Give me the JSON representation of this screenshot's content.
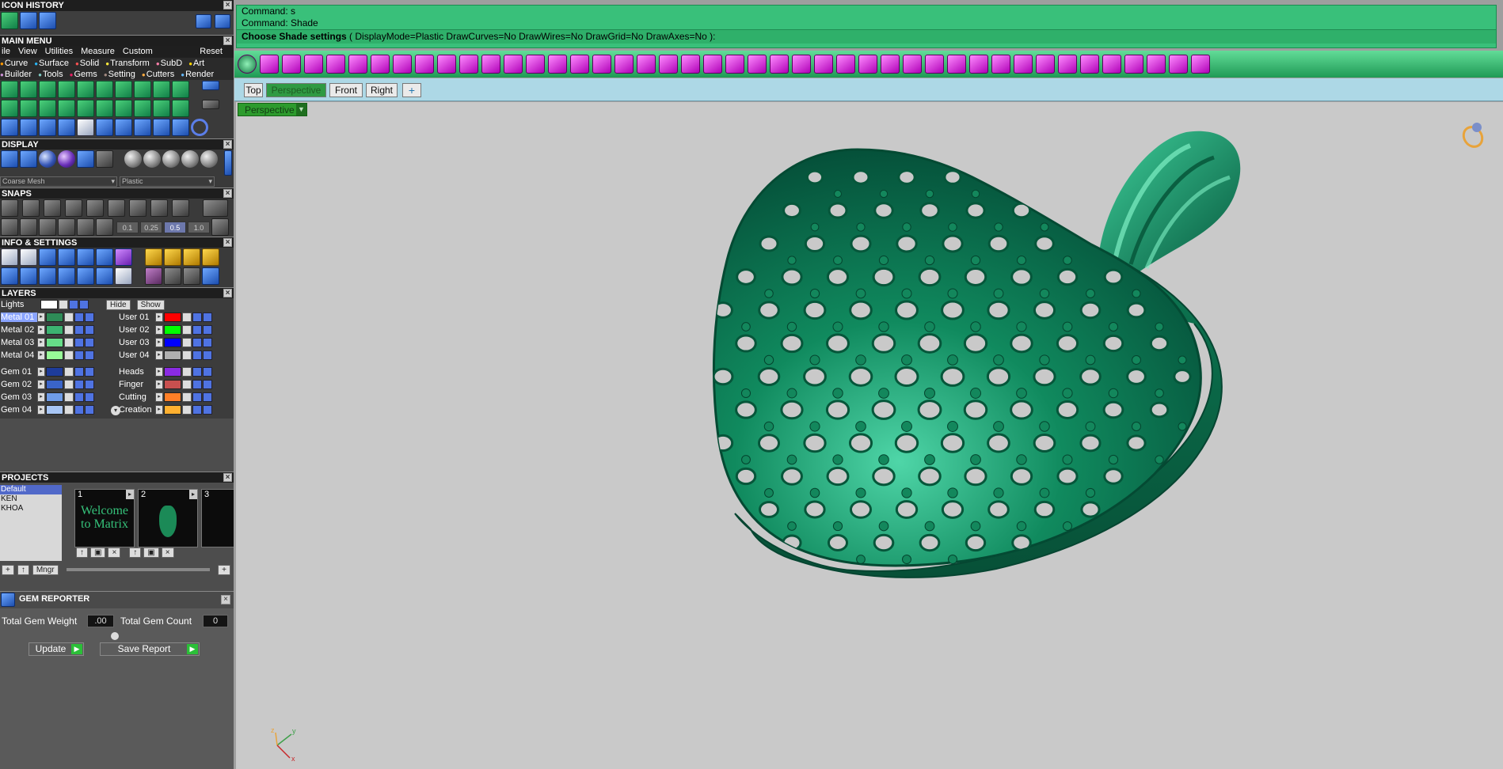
{
  "panels": {
    "icon_history": "ICON HISTORY",
    "main_menu": "MAIN MENU",
    "display": "DISPLAY",
    "snaps": "SNAPS",
    "info_settings": "INFO & SETTINGS",
    "layers": "LAYERS",
    "projects": "PROJECTS",
    "gem_reporter": "GEM REPORTER"
  },
  "main_menu": {
    "items": [
      "ile",
      "View",
      "Utilities",
      "Measure",
      "Custom"
    ],
    "reset": "Reset",
    "categories_row1": [
      "Curve",
      "Surface",
      "Solid",
      "Transform",
      "SubD",
      "Art"
    ],
    "categories_row2": [
      "Builder",
      "Tools",
      "Gems",
      "Setting",
      "Cutters",
      "Render"
    ]
  },
  "display": {
    "mesh_select": "Coarse Mesh",
    "material_select": "Plastic"
  },
  "snaps": {
    "values": [
      "0.1",
      "0.25",
      "0.5",
      "1.0"
    ],
    "active_value": "0.5"
  },
  "layers": {
    "lights_label": "Lights",
    "hide_label": "Hide",
    "show_label": "Show",
    "left": [
      {
        "name": "Metal 01",
        "color": "#2e8b57",
        "selected": true
      },
      {
        "name": "Metal 02",
        "color": "#3cb371"
      },
      {
        "name": "Metal 03",
        "color": "#66dd88"
      },
      {
        "name": "Metal 04",
        "color": "#98fb98"
      },
      {
        "name": "Gem 01",
        "color": "#1e3c9a"
      },
      {
        "name": "Gem 02",
        "color": "#3a64c8"
      },
      {
        "name": "Gem 03",
        "color": "#6f9ce8"
      },
      {
        "name": "Gem 04",
        "color": "#a8c6f5"
      }
    ],
    "right": [
      {
        "name": "User 01",
        "color": "#ff0000"
      },
      {
        "name": "User 02",
        "color": "#00ff00"
      },
      {
        "name": "User 03",
        "color": "#0000ff"
      },
      {
        "name": "User 04",
        "color": "#b0b0b0"
      },
      {
        "name": "Heads",
        "color": "#8a2be2"
      },
      {
        "name": "Finger",
        "color": "#c8504f"
      },
      {
        "name": "Cutting",
        "color": "#ff7f27"
      },
      {
        "name": "Creation",
        "color": "#ffb030"
      }
    ]
  },
  "projects": {
    "list": [
      "Default",
      "KEN",
      "KHOA"
    ],
    "selected": "Default",
    "thumbnails": [
      {
        "number": "1",
        "caption": "Welcome to Matrix"
      },
      {
        "number": "2",
        "caption": ""
      },
      {
        "number": "3",
        "caption": ""
      }
    ],
    "manager_button": "Mngr"
  },
  "gem_reporter": {
    "total_weight_label": "Total Gem Weight",
    "total_weight_value": ".00",
    "total_count_label": "Total Gem Count",
    "total_count_value": "0",
    "update_label": "Update",
    "save_report_label": "Save Report"
  },
  "command": {
    "line1": "Command: s",
    "line2": "Command: Shade",
    "line3_bold": "Choose Shade settings",
    "line3_rest": " ( DisplayMode=Plastic  DrawCurves=No  DrawWires=No  DrawGrid=No  DrawAxes=No ):"
  },
  "viewport": {
    "tabs": [
      "Top",
      "Perspective",
      "Front",
      "Right"
    ],
    "active_tab": "Perspective",
    "add_tab": "+",
    "view_dropdown": "Perspective",
    "axis_labels": {
      "x": "x",
      "y": "y",
      "z": "z"
    }
  },
  "colors": {
    "command_bg": "#39c07a",
    "viewport_bg": "#c9c9c9",
    "model_green": "#0f7a55",
    "tabbar_bg": "#add8e6"
  }
}
